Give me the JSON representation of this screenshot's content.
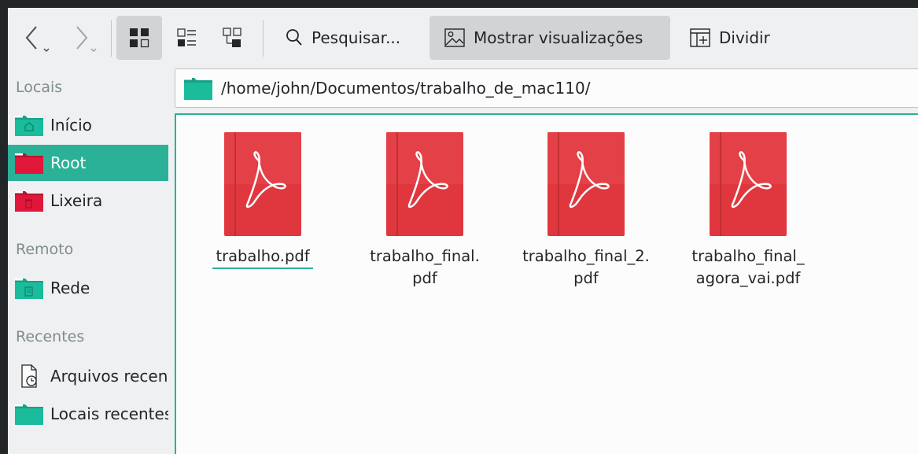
{
  "toolbar": {
    "search_label": "Pesquisar...",
    "preview_label": "Mostrar visualizações",
    "split_label": "Dividir"
  },
  "sidebar": {
    "sections": [
      {
        "title": "Locais",
        "items": [
          {
            "label": "Início",
            "icon": "home-folder-icon",
            "color": "#1abc9c"
          },
          {
            "label": "Root",
            "icon": "root-folder-icon",
            "color": "#e0173a"
          },
          {
            "label": "Lixeira",
            "icon": "trash-folder-icon",
            "color": "#e0173a"
          }
        ]
      },
      {
        "title": "Remoto",
        "items": [
          {
            "label": "Rede",
            "icon": "network-folder-icon",
            "color": "#1abc9c"
          }
        ]
      },
      {
        "title": "Recentes",
        "items": [
          {
            "label": "Arquivos recentes",
            "icon": "recent-files-icon"
          },
          {
            "label": "Locais recentes",
            "icon": "recent-locations-folder-icon",
            "color": "#1abc9c"
          }
        ]
      }
    ],
    "selected": "Root"
  },
  "location": {
    "path": "/home/john/Documentos/trabalho_de_mac110/"
  },
  "files": [
    {
      "line1": "trabalho.pdf",
      "line2": "",
      "icon": "pdf-file-icon"
    },
    {
      "line1": "trabalho_final.",
      "line2": "pdf",
      "icon": "pdf-file-icon"
    },
    {
      "line1": "trabalho_final_2.",
      "line2": "pdf",
      "icon": "pdf-file-icon"
    },
    {
      "line1": "trabalho_final_",
      "line2": "agora_vai.pdf",
      "icon": "pdf-file-icon"
    }
  ],
  "colors": {
    "accent": "#2bb198",
    "pdf_red": "#e0373e",
    "folder_teal": "#1abc9c",
    "folder_red": "#e0173a"
  }
}
